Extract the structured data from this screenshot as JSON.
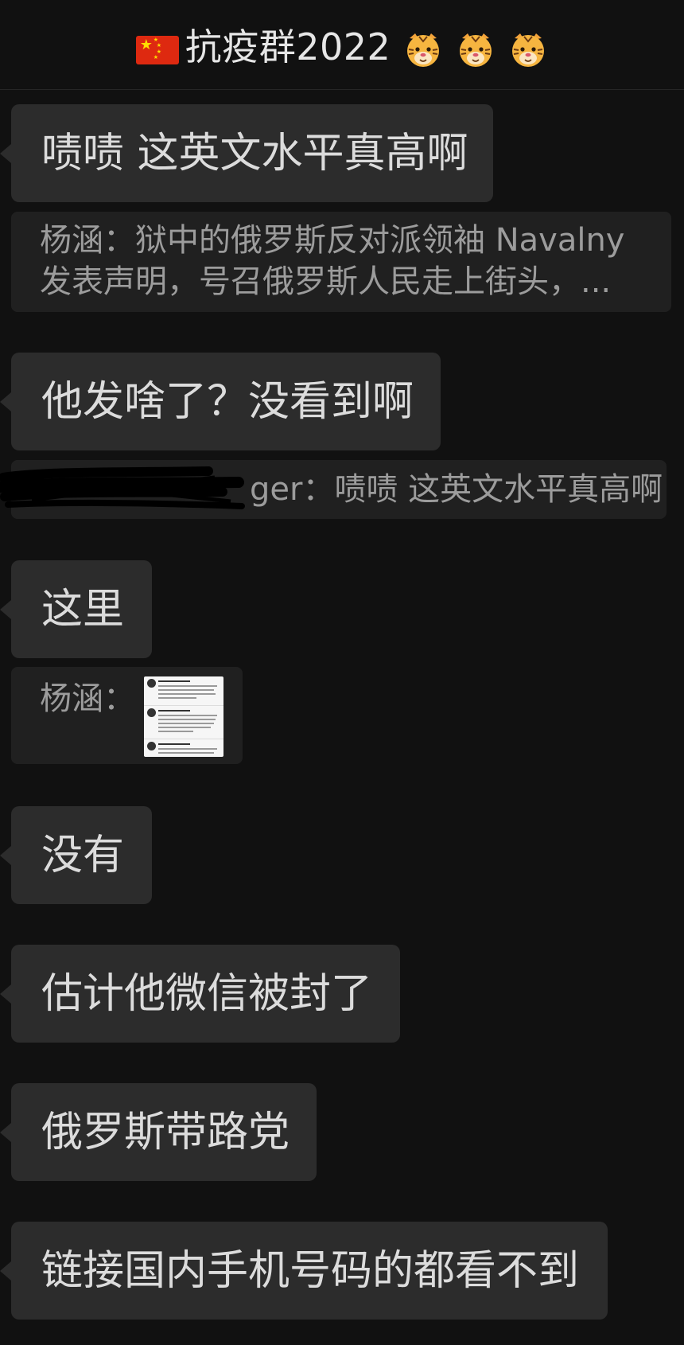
{
  "header": {
    "title": "抗疫群2022",
    "flag_icon": "china-flag-icon",
    "emoji_icons": [
      "tiger-face-icon",
      "tiger-face-icon",
      "tiger-face-icon"
    ]
  },
  "messages": [
    {
      "type": "bubble",
      "text": "啧啧 这英文水平真高啊"
    },
    {
      "type": "quote",
      "lines": [
        "杨涵：狱中的俄罗斯反对派领袖 Navalny",
        "发表声明，号召俄罗斯人民走上街头，..."
      ]
    },
    {
      "type": "bubble",
      "text": "他发啥了？没看到啊"
    },
    {
      "type": "quote",
      "sender_visible": "ger：",
      "text": "啧啧 这英文水平真高啊"
    },
    {
      "type": "bubble",
      "text": "这里"
    },
    {
      "type": "quote",
      "sender": "杨涵：",
      "attachment": "tweet-screenshot-thumbnail"
    },
    {
      "type": "bubble",
      "text": "没有"
    },
    {
      "type": "bubble",
      "text": "估计他微信被封了"
    },
    {
      "type": "bubble",
      "text": "俄罗斯带路党"
    },
    {
      "type": "bubble",
      "text": "链接国内手机号码的都看不到"
    }
  ],
  "colors": {
    "background": "#111111",
    "bubble": "#2c2c2c",
    "quote": "#202020",
    "text": "#dcdcdc",
    "quote_text": "#9c9c9c"
  }
}
